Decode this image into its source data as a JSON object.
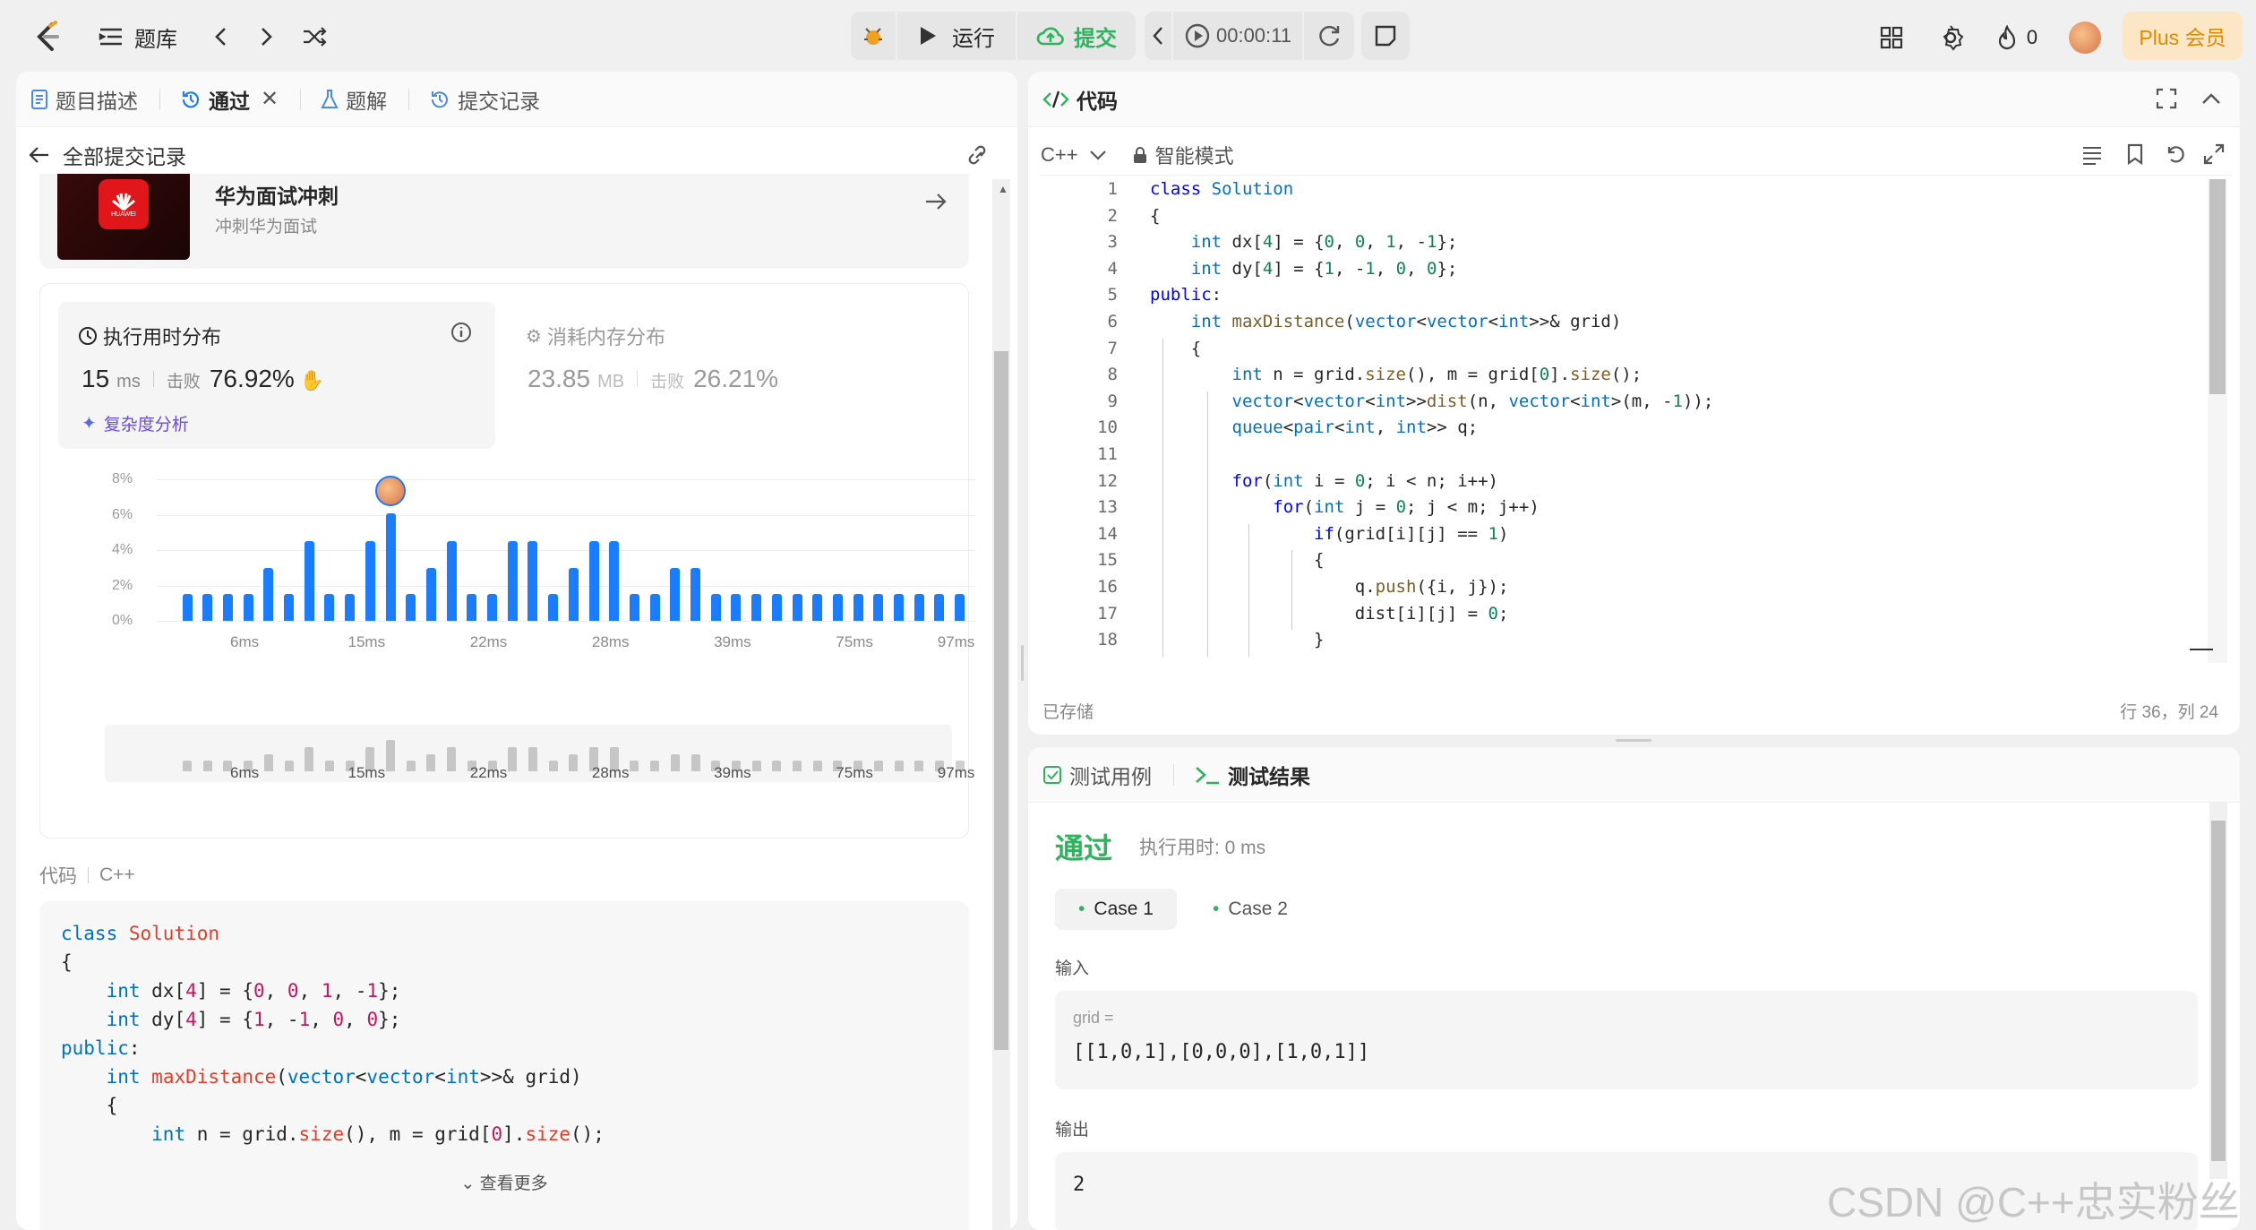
{
  "topbar": {
    "problem_bank": "题库",
    "run": "运行",
    "submit": "提交",
    "timer": "00:00:11",
    "streak": "0",
    "plus": "Plus 会员"
  },
  "left_tabs": {
    "desc": "题目描述",
    "passed": "通过",
    "solution": "题解",
    "history": "提交记录"
  },
  "subheader": {
    "back": "全部提交记录"
  },
  "promo": {
    "title": "华为面试冲刺",
    "subtitle": "冲刺华为面试",
    "brand": "HUAWEI"
  },
  "runtime": {
    "title": "执行用时分布",
    "value": "15",
    "unit": "ms",
    "beats_label": "击败",
    "beats": "76.92%",
    "analysis": "复杂度分析"
  },
  "memory": {
    "title": "消耗内存分布",
    "value": "23.85",
    "unit": "MB",
    "beats_label": "击败",
    "beats": "26.21%"
  },
  "chart_data": {
    "type": "bar",
    "yticks": [
      "8%",
      "6%",
      "4%",
      "2%",
      "0%"
    ],
    "ylim": [
      0,
      8
    ],
    "xticks": [
      "6ms",
      "15ms",
      "22ms",
      "28ms",
      "39ms",
      "75ms",
      "97ms"
    ],
    "values": [
      1.5,
      1.5,
      1.5,
      1.5,
      3,
      1.5,
      4.5,
      1.5,
      1.5,
      4.5,
      6.1,
      1.5,
      3,
      4.5,
      1.5,
      1.5,
      4.5,
      4.5,
      1.5,
      3,
      4.5,
      4.5,
      1.5,
      1.5,
      3,
      3,
      1.5,
      1.5,
      1.5,
      1.5,
      1.5,
      1.5,
      1.5,
      1.5,
      1.5,
      1.5,
      1.5,
      1.5,
      1.5
    ],
    "highlight_index": 10,
    "grid": true
  },
  "code_section": {
    "label": "代码",
    "lang": "C++",
    "more": "查看更多"
  },
  "code_snippet": [
    "class Solution",
    "{",
    "    int dx[4] = {0, 0, 1, -1};",
    "    int dy[4] = {1, -1, 0, 0};",
    "public:",
    "    int maxDistance(vector<vector<int>>& grid)",
    "    {",
    "        int n = grid.size(), m = grid[0].size();"
  ],
  "editor": {
    "title": "代码",
    "lang": "C++",
    "mode": "智能模式",
    "saved": "已存储",
    "position": "行 36，列 24",
    "lines": [
      "class Solution",
      "{",
      "    int dx[4] = {0, 0, 1, -1};",
      "    int dy[4] = {1, -1, 0, 0};",
      "public:",
      "    int maxDistance(vector<vector<int>>& grid)",
      "    {",
      "        int n = grid.size(), m = grid[0].size();",
      "        vector<vector<int>>dist(n, vector<int>(m, -1));",
      "        queue<pair<int, int>> q;",
      "",
      "        for(int i = 0; i < n; i++)",
      "            for(int j = 0; j < m; j++)",
      "                if(grid[i][j] == 1)",
      "                {",
      "                    q.push({i, j});",
      "                    dist[i][j] = 0;",
      "                }"
    ]
  },
  "test": {
    "tab_cases": "测试用例",
    "tab_result": "测试结果",
    "status": "通过",
    "runtime": "执行用时: 0 ms",
    "case1": "Case 1",
    "case2": "Case 2",
    "input_label": "输入",
    "var": "grid =",
    "input": "[[1,0,1],[0,0,0],[1,0,1]]",
    "output_label": "输出",
    "output": "2"
  },
  "watermark": "CSDN @C++忠实粉丝"
}
